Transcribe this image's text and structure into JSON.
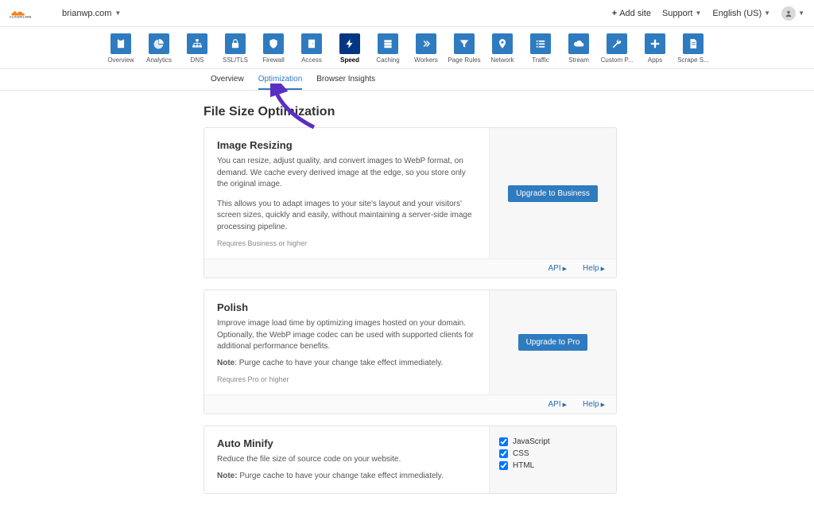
{
  "topbar": {
    "site": "brianwp.com",
    "add_site": "Add site",
    "support": "Support",
    "language": "English (US)"
  },
  "nav": [
    {
      "label": "Overview",
      "icon": "clipboard"
    },
    {
      "label": "Analytics",
      "icon": "pie"
    },
    {
      "label": "DNS",
      "icon": "tree"
    },
    {
      "label": "SSL/TLS",
      "icon": "lock"
    },
    {
      "label": "Firewall",
      "icon": "shield"
    },
    {
      "label": "Access",
      "icon": "door"
    },
    {
      "label": "Speed",
      "icon": "bolt",
      "active": true
    },
    {
      "label": "Caching",
      "icon": "db"
    },
    {
      "label": "Workers",
      "icon": "chevrons"
    },
    {
      "label": "Page Rules",
      "icon": "funnel"
    },
    {
      "label": "Network",
      "icon": "pin"
    },
    {
      "label": "Traffic",
      "icon": "list"
    },
    {
      "label": "Stream",
      "icon": "cloud"
    },
    {
      "label": "Custom P...",
      "icon": "wrench"
    },
    {
      "label": "Apps",
      "icon": "plus"
    },
    {
      "label": "Scrape S...",
      "icon": "page"
    }
  ],
  "subnav": {
    "overview": "Overview",
    "optimization": "Optimization",
    "browser_insights": "Browser Insights"
  },
  "page": {
    "title": "File Size Optimization"
  },
  "cards": {
    "image_resizing": {
      "title": "Image Resizing",
      "desc1": "You can resize, adjust quality, and convert images to WebP format, on demand. We cache every derived image at the edge, so you store only the original image.",
      "desc2": "This allows you to adapt images to your site's layout and your visitors' screen sizes, quickly and easily, without maintaining a server-side image processing pipeline.",
      "requires": "Requires Business or higher",
      "button": "Upgrade to Business",
      "api": "API",
      "help": "Help"
    },
    "polish": {
      "title": "Polish",
      "desc": "Improve image load time by optimizing images hosted on your domain. Optionally, the WebP image codec can be used with supported clients for additional performance benefits.",
      "note_label": "Note",
      "note_text": ": Purge cache to have your change take effect immediately.",
      "requires": "Requires Pro or higher",
      "button": "Upgrade to Pro",
      "api": "API",
      "help": "Help"
    },
    "auto_minify": {
      "title": "Auto Minify",
      "desc": "Reduce the file size of source code on your website.",
      "note_label": "Note:",
      "note_text": " Purge cache to have your change take effect immediately.",
      "js": "JavaScript",
      "css": "CSS",
      "html": "HTML"
    }
  }
}
